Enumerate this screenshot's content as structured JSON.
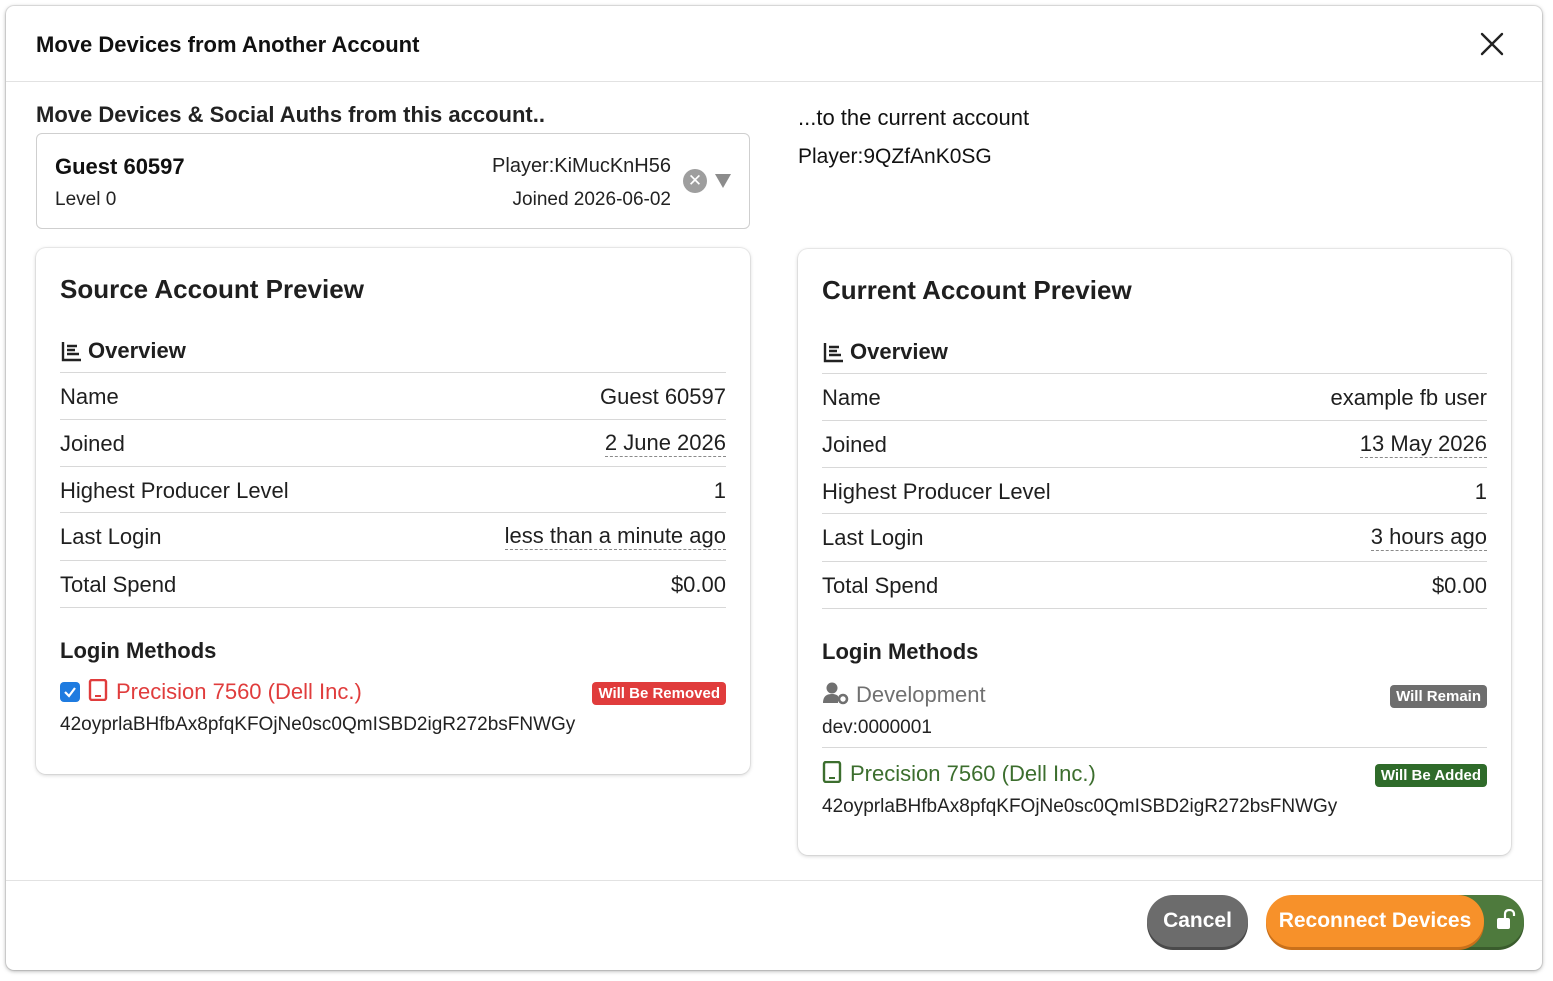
{
  "modal": {
    "title": "Move Devices from Another Account"
  },
  "source_select": {
    "heading": "Move Devices & Social Auths from this account..",
    "name": "Guest 60597",
    "level": "Level 0",
    "player": "Player:KiMucKnH56",
    "joined": "Joined 2026-06-02",
    "clear_glyph": "✕"
  },
  "target": {
    "heading": "...to the current account",
    "player": "Player:9QZfAnK0SG"
  },
  "source_card": {
    "title": "Source Account Preview",
    "overview_label": "Overview",
    "rows": [
      {
        "label": "Name",
        "value": "Guest 60597"
      },
      {
        "label": "Joined",
        "value": "2 June 2026"
      },
      {
        "label": "Highest Producer Level",
        "value": "1"
      },
      {
        "label": "Last Login",
        "value": "less than a minute ago"
      },
      {
        "label": "Total Spend",
        "value": "$0.00"
      }
    ],
    "login_methods_label": "Login Methods",
    "methods": [
      {
        "icon": "tablet-icon",
        "name": "Precision 7560 (Dell Inc.)",
        "id": "42oyprlaBHfbAx8pfqKFOjNe0sc0QmISBD2igR272bsFNWGy",
        "badge": "Will Be Removed",
        "color": "#e03c3c",
        "badge_color": "#e03c3c",
        "checked": true
      }
    ]
  },
  "current_card": {
    "title": "Current Account Preview",
    "overview_label": "Overview",
    "rows": [
      {
        "label": "Name",
        "value": "example fb user"
      },
      {
        "label": "Joined",
        "value": "13 May 2026"
      },
      {
        "label": "Highest Producer Level",
        "value": "1"
      },
      {
        "label": "Last Login",
        "value": "3 hours ago"
      },
      {
        "label": "Total Spend",
        "value": "$0.00"
      }
    ],
    "login_methods_label": "Login Methods",
    "methods": [
      {
        "icon": "user-gear-icon",
        "name": "Development",
        "id": "dev:0000001",
        "badge": "Will Remain",
        "color": "#707070",
        "badge_color": "#6e6e6e"
      },
      {
        "icon": "tablet-icon",
        "name": "Precision 7560 (Dell Inc.)",
        "id": "42oyprlaBHfbAx8pfqKFOjNe0sc0QmISBD2igR272bsFNWGy",
        "badge": "Will Be Added",
        "color": "#3c6e2e",
        "badge_color": "#2f6b2a"
      }
    ]
  },
  "footer": {
    "cancel_label": "Cancel",
    "reconnect_label": "Reconnect Devices",
    "lock_icon": "unlock-icon"
  },
  "colors": {
    "accent_orange": "#f7912a",
    "remove_red": "#e03c3c",
    "add_green": "#2f6b2a",
    "checkbox_blue": "#1e7be0"
  }
}
